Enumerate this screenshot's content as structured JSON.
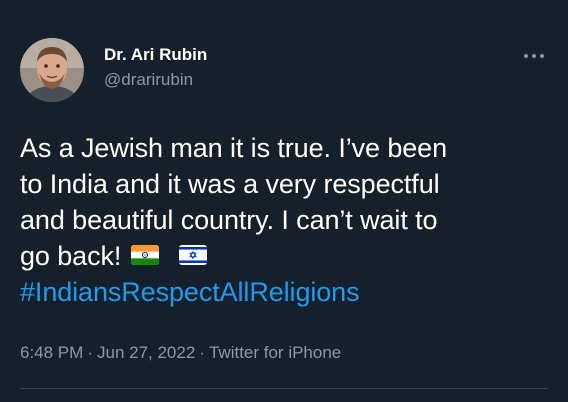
{
  "author": {
    "display_name": "Dr. Ari Rubin",
    "handle": "@drarirubin",
    "avatar_icon": "profile-photo"
  },
  "more_icon": "more-options-icon",
  "tweet": {
    "lines": [
      "As a Jewish man it is true. I’ve been",
      "to India and it was a very respectful",
      "and beautiful country. I can’t wait to",
      "go back!"
    ],
    "flags": [
      "india-flag-emoji",
      "israel-flag-emoji"
    ],
    "hashtag": "#IndiansRespectAllReligions"
  },
  "meta": {
    "time": "6:48 PM",
    "date": "Jun 27, 2022",
    "separator": "·",
    "source": "Twitter for iPhone"
  },
  "colors": {
    "background": "#15202b",
    "text": "#ffffff",
    "secondary_text": "#8b98a5",
    "link": "#1d9bf0",
    "divider": "#38444d"
  }
}
